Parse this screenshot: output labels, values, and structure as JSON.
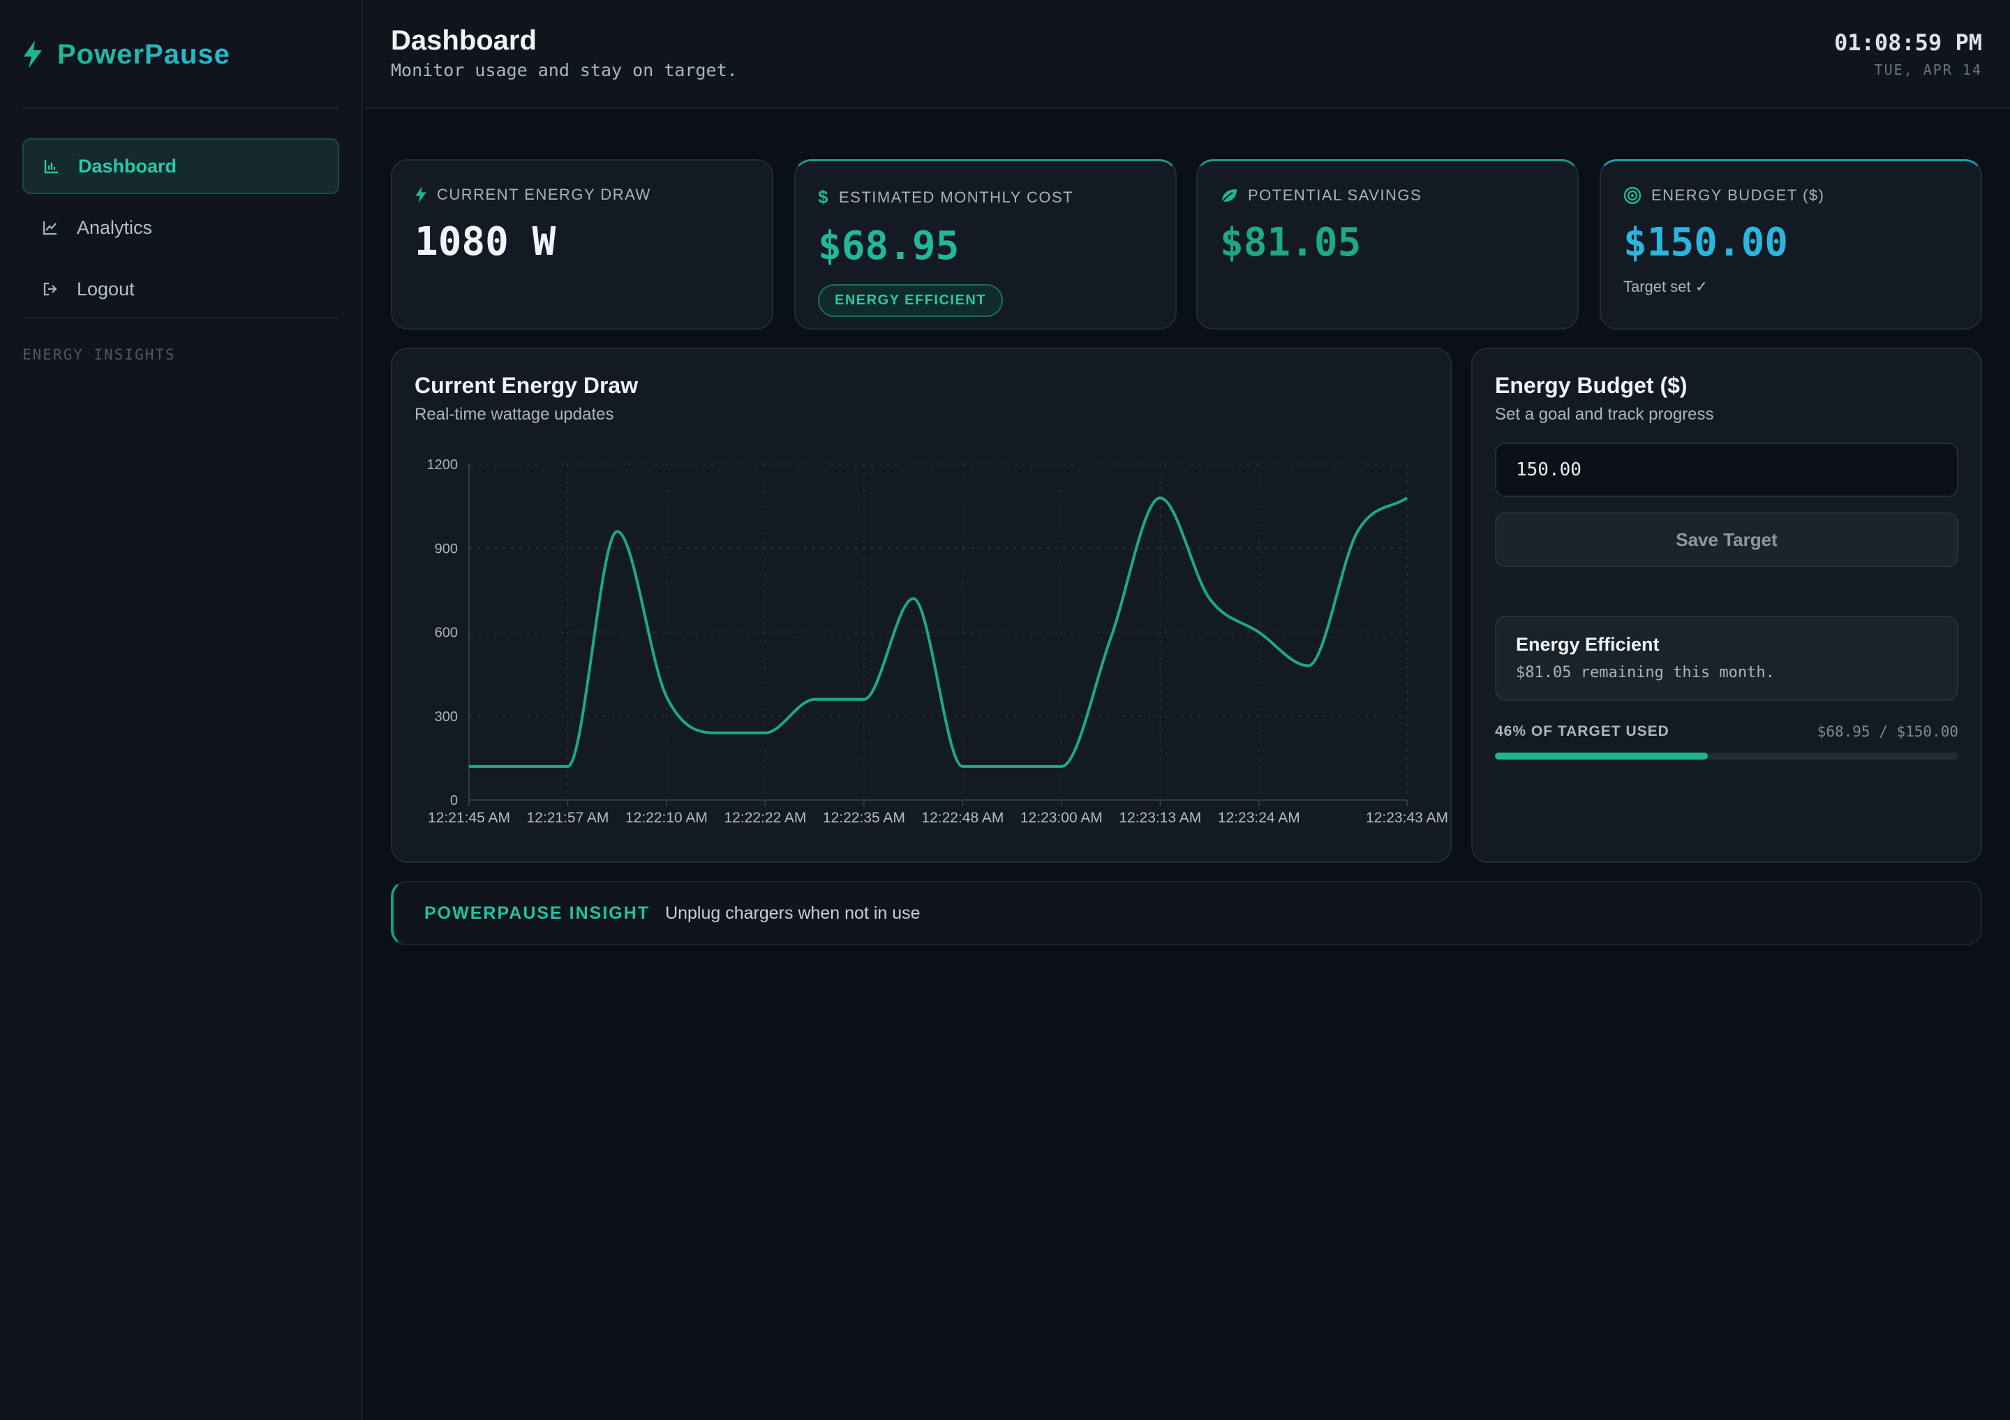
{
  "app": {
    "name": "PowerPause"
  },
  "sidebar": {
    "items": [
      {
        "label": "Dashboard",
        "icon": "bar-chart-icon",
        "active": true
      },
      {
        "label": "Analytics",
        "icon": "line-chart-icon",
        "active": false
      },
      {
        "label": "Logout",
        "icon": "logout-icon",
        "active": false
      }
    ],
    "section_label": "ENERGY INSIGHTS"
  },
  "header": {
    "title": "Dashboard",
    "subtitle": "Monitor usage and stay on target.",
    "time": "01:08:59 PM",
    "date": "TUE, APR 14"
  },
  "kpis": {
    "draw": {
      "label": "CURRENT ENERGY DRAW",
      "value": "1080 W"
    },
    "cost": {
      "label": "ESTIMATED MONTHLY COST",
      "value": "$68.95",
      "badge": "ENERGY EFFICIENT"
    },
    "savings": {
      "label": "POTENTIAL SAVINGS",
      "value": "$81.05"
    },
    "budget": {
      "label": "ENERGY BUDGET ($)",
      "value": "$150.00",
      "note": "Target set ✓"
    }
  },
  "colors": {
    "accent": "#1fb88a",
    "cost": "#22b89a",
    "budget": "#2bb6e0",
    "line": "#1fa981"
  },
  "chart_panel": {
    "title": "Current Energy Draw",
    "subtitle": "Real-time wattage updates"
  },
  "chart_data": {
    "type": "line",
    "x": [
      "12:21:45 AM",
      "12:21:51 AM",
      "12:21:57 AM",
      "12:22:04 AM",
      "12:22:10 AM",
      "12:22:16 AM",
      "12:22:22 AM",
      "12:22:29 AM",
      "12:22:35 AM",
      "12:22:41 AM",
      "12:22:48 AM",
      "12:22:54 AM",
      "12:23:00 AM",
      "12:23:06 AM",
      "12:23:13 AM",
      "12:23:18 AM",
      "12:23:24 AM",
      "12:23:31 AM",
      "12:23:37 AM",
      "12:23:43 AM"
    ],
    "x_tick_labels": [
      "12:21:45 AM",
      "12:21:57 AM",
      "12:22:10 AM",
      "12:22:22 AM",
      "12:22:35 AM",
      "12:22:48 AM",
      "12:23:00 AM",
      "12:23:13 AM",
      "12:23:24 AM",
      "12:23:43 AM"
    ],
    "series": [
      {
        "values": [
          120,
          120,
          120,
          960,
          370,
          240,
          240,
          360,
          360,
          720,
          120,
          120,
          120,
          580,
          1080,
          720,
          600,
          480,
          960,
          1080
        ]
      }
    ],
    "ylim": [
      0,
      1200
    ],
    "y_ticks": [
      0,
      300,
      600,
      900,
      1200
    ],
    "grid": true
  },
  "budget_panel": {
    "title": "Energy Budget ($)",
    "subtitle": "Set a goal and track progress",
    "input_value": "150.00",
    "save_label": "Save Target",
    "status_title": "Energy Efficient",
    "status_text": "$81.05 remaining this month.",
    "progress_label": "46% OF TARGET USED",
    "progress_amount": "$68.95 / $150.00",
    "progress_fraction": 0.46
  },
  "insight": {
    "tag": "POWERPAUSE INSIGHT",
    "text": "Unplug chargers when not in use"
  }
}
